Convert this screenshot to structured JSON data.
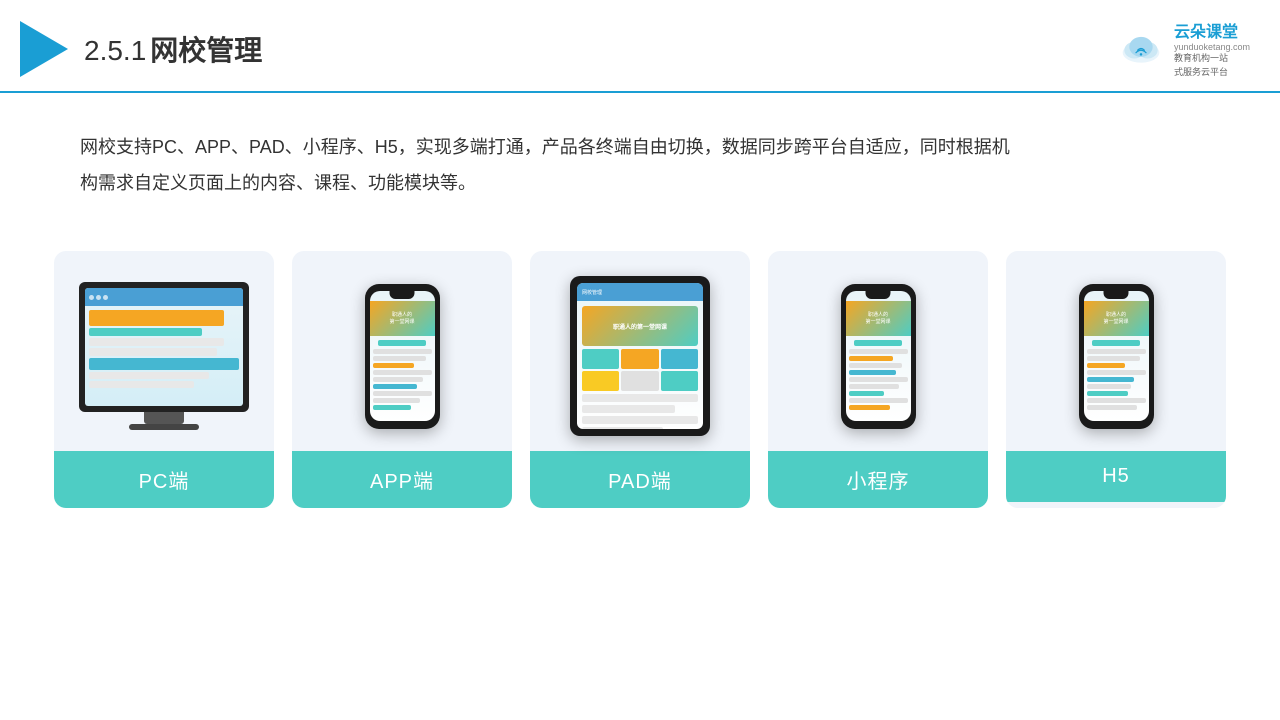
{
  "header": {
    "section_number": "2.5.1",
    "title": "网校管理",
    "logo_brand": "云朵课堂",
    "logo_url": "yunduoketang.com",
    "logo_tagline": "教育机构一站\n式服务云平台"
  },
  "description": {
    "text": "网校支持PC、APP、PAD、小程序、H5，实现多端打通，产品各终端自由切换，数据同步跨平台自适应，同时根据机构需求自定义页面上的内容、课程、功能模块等。"
  },
  "cards": [
    {
      "id": "pc",
      "label": "PC端",
      "color": "#4ecdc4"
    },
    {
      "id": "app",
      "label": "APP端",
      "color": "#4ecdc4"
    },
    {
      "id": "pad",
      "label": "PAD端",
      "color": "#4ecdc4"
    },
    {
      "id": "miniapp",
      "label": "小程序",
      "color": "#4ecdc4"
    },
    {
      "id": "h5",
      "label": "H5",
      "color": "#4ecdc4"
    }
  ],
  "colors": {
    "accent": "#4ecdc4",
    "header_border": "#1a9ed4",
    "title_color": "#333333"
  }
}
